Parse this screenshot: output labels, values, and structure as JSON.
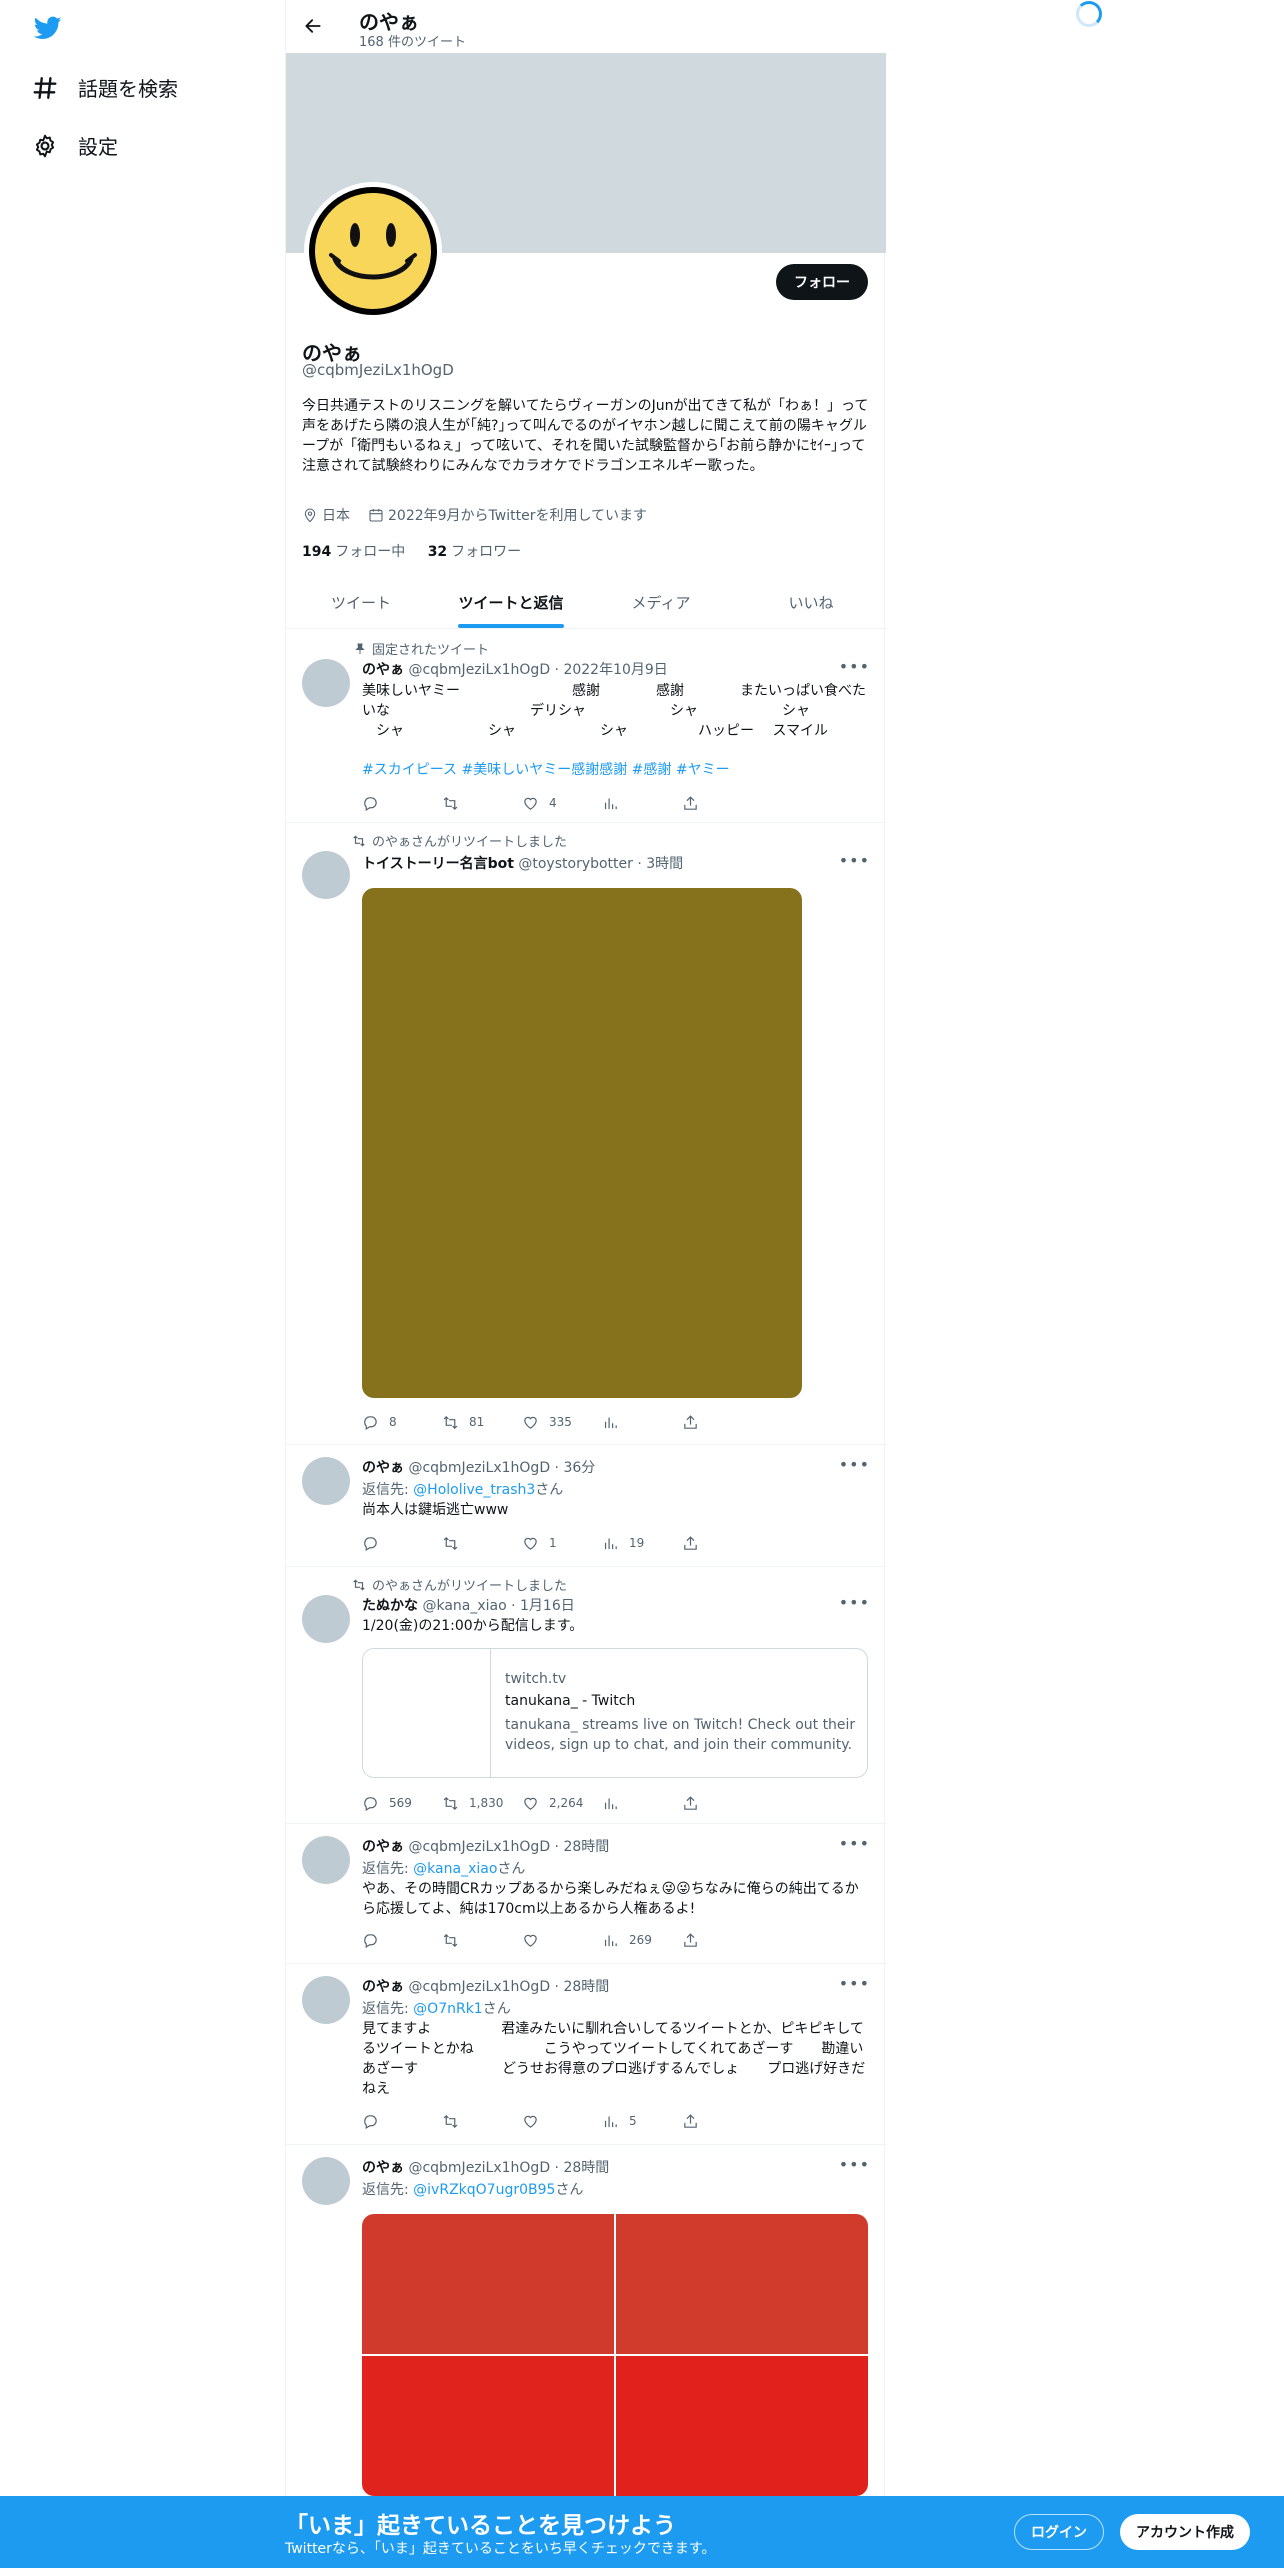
{
  "sidebar": {
    "items": [
      {
        "label": "話題を検索",
        "icon": "hashtag-icon"
      },
      {
        "label": "設定",
        "icon": "gear-icon"
      }
    ]
  },
  "header": {
    "name": "のやぁ",
    "tweet_count": "168 件のツイート"
  },
  "profile": {
    "name": "のやぁ",
    "handle": "@cqbmJeziLx1hOgD",
    "follow_label": "フォロー",
    "bio": "今日共通テストのリスニングを解いてたらヴィーガンのJunが出てきて私が「わぁ！」って声をあげたら隣の浪人生が｢純?｣って叫んでるのがイヤホン越しに聞こえて前の陽キャグループが「衛門もいるねぇ」って呟いて、それを聞いた試験監督から｢お前ら静かにｾｲｰ｣って注意されて試験終わりにみんなでカラオケでドラゴンエネルギー歌った。",
    "location": "日本",
    "joined": "2022年9月からTwitterを利用しています",
    "following_count": "194",
    "following_label": "フォロー中",
    "followers_count": "32",
    "followers_label": "フォロワー"
  },
  "tabs": [
    {
      "label": "ツイート",
      "active": false
    },
    {
      "label": "ツイートと返信",
      "active": true
    },
    {
      "label": "メディア",
      "active": false
    },
    {
      "label": "いいね",
      "active": false
    }
  ],
  "tweets": [
    {
      "context": "固定されたツイート",
      "name": "のやぁ",
      "meta": "@cqbmJeziLx1hOgD · 2022年10月9日",
      "text": "美味しいヤミー　　　　　　　　感謝　　　　感謝　　　　またいっぱい食べたいな　　　　　　　　　　デリシャ　　　　　　シャ　　　　　　シャ\n　シャ　　　　　　シャ　　　　　　シャ　　　　　ハッピー　 スマイル",
      "hashtags": "#スカイピース #美味しいヤミー感謝感謝 #感謝 #ヤミー",
      "replies": "",
      "retweets": "",
      "likes": "4",
      "views": ""
    },
    {
      "context": "のやぁさんがリツイートしました",
      "name": "トイストーリー名言bot",
      "meta": "@toystorybotter · 3時間",
      "replies": "8",
      "retweets": "81",
      "likes": "335",
      "views": ""
    },
    {
      "name": "のやぁ",
      "meta": "@cqbmJeziLx1hOgD · 36分",
      "reply_prefix": "返信先: ",
      "reply_to": "@Hololive_trash3",
      "reply_suffix": "さん",
      "text": "尚本人は鍵垢逃亡www",
      "replies": "",
      "retweets": "",
      "likes": "1",
      "views": "19"
    },
    {
      "context": "のやぁさんがリツイートしました",
      "name": "たぬかな",
      "meta": "@kana_xiao · 1月16日",
      "text": "1/20(金)の21:00から配信します。",
      "card": {
        "domain": "twitch.tv",
        "title": "tanukana_ - Twitch",
        "description": "tanukana_ streams live on Twitch! Check out their videos, sign up to chat, and join their community."
      },
      "replies": "569",
      "retweets": "1,830",
      "likes": "2,264",
      "views": ""
    },
    {
      "name": "のやぁ",
      "meta": "@cqbmJeziLx1hOgD · 28時間",
      "reply_prefix": "返信先: ",
      "reply_to": "@kana_xiao",
      "reply_suffix": "さん",
      "text": "やあ、その時間CRカップあるから楽しみだねぇ😜😜ちなみに俺らの純出てるから応援してよ、純は170cm以上あるから人権あるよ!",
      "replies": "",
      "retweets": "",
      "likes": "",
      "views": "269"
    },
    {
      "name": "のやぁ",
      "meta": "@cqbmJeziLx1hOgD · 28時間",
      "reply_prefix": "返信先: ",
      "reply_to": "@O7nRk1",
      "reply_suffix": "さん",
      "text": "見てますよ　　　　　君達みたいに馴れ合いしてるツイートとか、ピキピキしてるツイートとかね　　　　　こうやってツイートしてくれてあざーす　　勘違いあざーす　　　　　　どうせお得意のプロ逃げするんでしょ　　プロ逃げ好きだねえ",
      "replies": "",
      "retweets": "",
      "likes": "",
      "views": "5"
    },
    {
      "name": "のやぁ",
      "meta": "@cqbmJeziLx1hOgD · 28時間",
      "reply_prefix": "返信先: ",
      "reply_to": "@ivRZkqO7ugr0B95",
      "reply_suffix": "さん"
    }
  ],
  "bottom_bar": {
    "title": "「いま」起きていることを見つけよう",
    "subtitle": "Twitterなら、「いま」起きていることをいち早くチェックできます。",
    "login_label": "ログイン",
    "signup_label": "アカウント作成"
  },
  "colors": {
    "accent": "#1d9bf0",
    "banner": "#cfd9de",
    "media1": "#86711c",
    "media4": "#d23b2b"
  }
}
